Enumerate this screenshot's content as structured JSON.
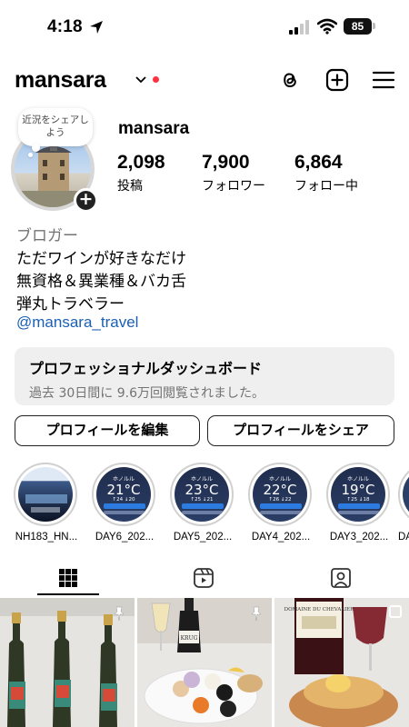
{
  "status_bar": {
    "time": "4:18",
    "battery": "85"
  },
  "header": {
    "username": "mansara"
  },
  "note": {
    "text": "近況をシェアしよう"
  },
  "profile": {
    "name": "mansara",
    "stats": [
      {
        "value": "2,098",
        "label": "投稿"
      },
      {
        "value": "7,900",
        "label": "フォロワー"
      },
      {
        "value": "6,864",
        "label": "フォロー中"
      }
    ]
  },
  "bio": {
    "category": "ブロガー",
    "lines": [
      "ただワインが好きなだけ",
      "無資格＆異業種＆バカ舌",
      "弾丸トラベラー"
    ],
    "link": "@mansara_travel"
  },
  "dashboard": {
    "title": "プロフェッショナルダッシュボード",
    "subtitle": "過去 30日間に 9.6万回閲覧されました。"
  },
  "buttons": {
    "edit": "プロフィールを編集",
    "share": "プロフィールをシェア"
  },
  "highlights": [
    {
      "label": "NH183_HN..."
    },
    {
      "label": "DAY6_202...",
      "city": "ホノルル",
      "temp": "21°C",
      "hilo": "↑24 ↓20"
    },
    {
      "label": "DAY5_202...",
      "city": "ホノルル",
      "temp": "23°C",
      "hilo": "↑25 ↓21"
    },
    {
      "label": "DAY4_202...",
      "city": "ホノルル",
      "temp": "22°C",
      "hilo": "↑26 ↓22"
    },
    {
      "label": "DAY3_202...",
      "city": "ホノルル",
      "temp": "19°C",
      "hilo": "↑25 ↓18"
    },
    {
      "label": "DA"
    }
  ],
  "grid": {
    "post2_label": "KRUG",
    "post3_label": "DOMAINE DU CHEVALIER"
  },
  "icons": {
    "location": "location-arrow-icon",
    "signal": "cellular-signal-icon",
    "wifi": "wifi-icon",
    "threads": "threads-icon",
    "create": "plus-square-icon",
    "menu": "hamburger-menu-icon",
    "grid": "grid-icon",
    "reels": "reels-icon",
    "tagged": "tagged-icon",
    "pin": "pin-icon"
  },
  "colors": {
    "link": "#1a5fb4",
    "notification_dot": "#ff3040",
    "dashboard_bg": "#efefef"
  }
}
